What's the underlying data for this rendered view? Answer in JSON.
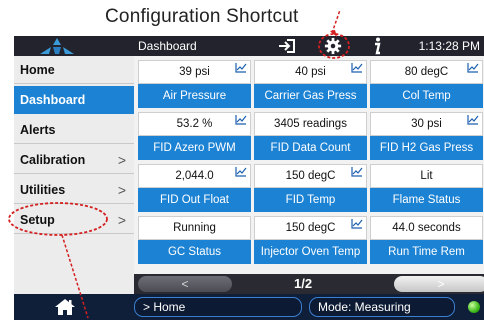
{
  "callout": {
    "title": "Configuration Shortcut"
  },
  "topbar": {
    "title": "Dashboard",
    "time": "1:13:28 PM",
    "icons": [
      "logo-icon",
      "login-icon",
      "gear-icon",
      "info-icon"
    ]
  },
  "sidebar": {
    "items": [
      {
        "label": "Home",
        "active": false,
        "chevron": false
      },
      {
        "label": "Dashboard",
        "active": true,
        "chevron": false
      },
      {
        "label": "Alerts",
        "active": false,
        "chevron": false
      },
      {
        "label": "Calibration",
        "active": false,
        "chevron": true
      },
      {
        "label": "Utilities",
        "active": false,
        "chevron": true
      },
      {
        "label": "Setup",
        "active": false,
        "chevron": true
      }
    ],
    "chevron_glyph": ">"
  },
  "tiles": [
    {
      "value": "39 psi",
      "label": "Air Pressure",
      "spark": true
    },
    {
      "value": "40 psi",
      "label": "Carrier Gas Press",
      "spark": true
    },
    {
      "value": "80 degC",
      "label": "Col Temp",
      "spark": true
    },
    {
      "value": "53.2 %",
      "label": "FID Azero PWM",
      "spark": true
    },
    {
      "value": "3405 readings",
      "label": "FID Data Count",
      "spark": false
    },
    {
      "value": "30 psi",
      "label": "FID H2 Gas Press",
      "spark": true
    },
    {
      "value": "2,044.0",
      "label": "FID Out Float",
      "spark": true
    },
    {
      "value": "150 degC",
      "label": "FID Temp",
      "spark": true
    },
    {
      "value": "Lit",
      "label": "Flame Status",
      "spark": false
    },
    {
      "value": "Running",
      "label": "GC Status",
      "spark": false
    },
    {
      "value": "150 degC",
      "label": "Injector Oven Temp",
      "spark": true
    },
    {
      "value": "44.0 seconds",
      "label": "Run Time Rem",
      "spark": false
    }
  ],
  "pager": {
    "prev": "<",
    "page": "1/2",
    "next": ">"
  },
  "bottombar": {
    "breadcrumb": "> Home",
    "mode": "Mode: Measuring",
    "status_color": "#3cb81a"
  },
  "colors": {
    "accent": "#1c82d4",
    "callout": "#d42020",
    "topbar": "#23232d",
    "bottombar": "#0f1f3a"
  }
}
